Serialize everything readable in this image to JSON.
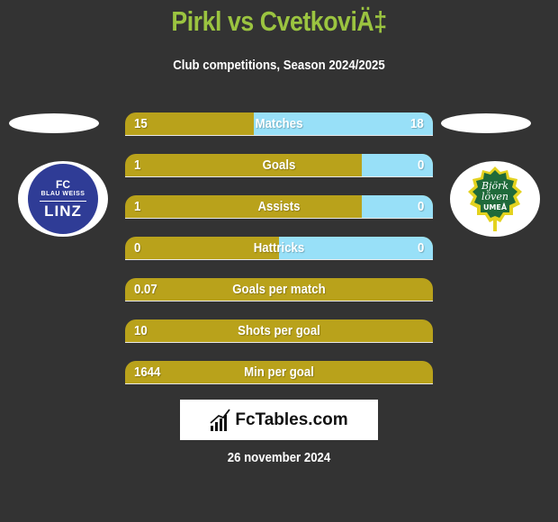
{
  "header": {
    "title": "Pirkl vs CvetkoviÄ‡",
    "subtitle": "Club competitions, Season 2024/2025"
  },
  "colors": {
    "background": "#333333",
    "title": "#9bc440",
    "left_bar": "#b9a21b",
    "right_bar": "#98e0f8"
  },
  "teams": {
    "left": {
      "name": "FC Blau Weiss Linz",
      "logo_lines": [
        "FC",
        "BLAU WEISS",
        "LINZ"
      ]
    },
    "right": {
      "name": "Björklöven Umeå",
      "logo_lines": [
        "Björk",
        "löven",
        "UMEÅ"
      ]
    }
  },
  "stats": [
    {
      "label": "Matches",
      "left": "15",
      "right": "18",
      "left_share": 0.4167
    },
    {
      "label": "Goals",
      "left": "1",
      "right": "0",
      "left_share": 0.77
    },
    {
      "label": "Assists",
      "left": "1",
      "right": "0",
      "left_share": 0.77
    },
    {
      "label": "Hattricks",
      "left": "0",
      "right": "0",
      "left_share": 0.5
    },
    {
      "label": "Goals per match",
      "left": "0.07",
      "right": "",
      "left_share": 1.0
    },
    {
      "label": "Shots per goal",
      "left": "10",
      "right": "",
      "left_share": 1.0
    },
    {
      "label": "Min per goal",
      "left": "1644",
      "right": "",
      "left_share": 1.0
    }
  ],
  "brand": {
    "text": "FcTables.com"
  },
  "footer": {
    "date": "26 november 2024"
  }
}
